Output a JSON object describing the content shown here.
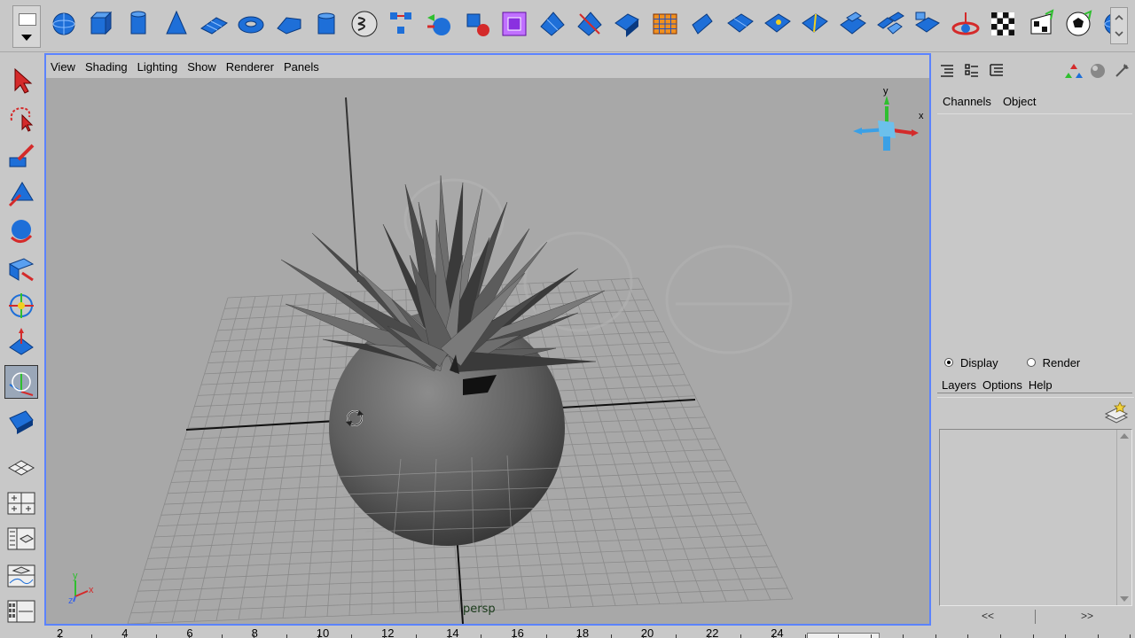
{
  "shelf": {
    "icons": [
      "sphere-icon",
      "cube-icon",
      "cylinder-icon",
      "cone-icon",
      "plane-icon",
      "torus-icon",
      "prism-icon",
      "pipe-icon",
      "helix-icon",
      "combine-icon",
      "separate-icon",
      "extract-icon",
      "smooth-icon",
      "extrude-face-icon",
      "split-polygon-icon",
      "wedge-face-icon",
      "bevel-icon",
      "poke-icon",
      "append-icon",
      "merge-edge-icon",
      "flip-edge-icon",
      "subdivide-icon",
      "edge-loop-icon",
      "cut-face-icon",
      "duplicate-face-icon",
      "mirror-icon",
      "soften-edge-icon",
      "checker-icon",
      "uv-editor-icon",
      "soccer-ball-icon"
    ]
  },
  "toolbox": {
    "tools": [
      "select-tool-icon",
      "lasso-tool-icon",
      "paint-select-icon",
      "move-tool-icon",
      "rotate-tool-icon",
      "scale-tool-icon",
      "universal-manipulator-icon",
      "soft-mod-icon",
      "show-manipulator-icon",
      "last-tool-icon"
    ],
    "layouts": [
      "single-perspective-layout-icon",
      "four-view-layout-icon",
      "outliner-persp-layout-icon",
      "graph-persp-layout-icon",
      "hypershade-layout-icon"
    ]
  },
  "viewport": {
    "menu": [
      "View",
      "Shading",
      "Lighting",
      "Show",
      "Renderer",
      "Panels"
    ],
    "camera": "persp",
    "axis_label_y": "y",
    "axis_label_x": "x",
    "axis_label_z": "z"
  },
  "channel_box": {
    "tabs": [
      "Channels",
      "Object"
    ]
  },
  "layer_editor": {
    "modes": [
      {
        "label": "Display",
        "selected": true
      },
      {
        "label": "Render",
        "selected": false
      }
    ],
    "menu": [
      "Layers",
      "Options",
      "Help"
    ],
    "scroll_left": "<<",
    "scroll_right": ">>"
  },
  "timeline": {
    "ticks": [
      "2",
      "4",
      "6",
      "8",
      "10",
      "12",
      "14",
      "16",
      "18",
      "20",
      "22",
      "24"
    ]
  },
  "colors": {
    "viewport_bg": "#a8a8a8",
    "panel_bg": "#c8c8c8",
    "active_border": "#5b83ff",
    "icon_blue": "#1e6fd8"
  }
}
